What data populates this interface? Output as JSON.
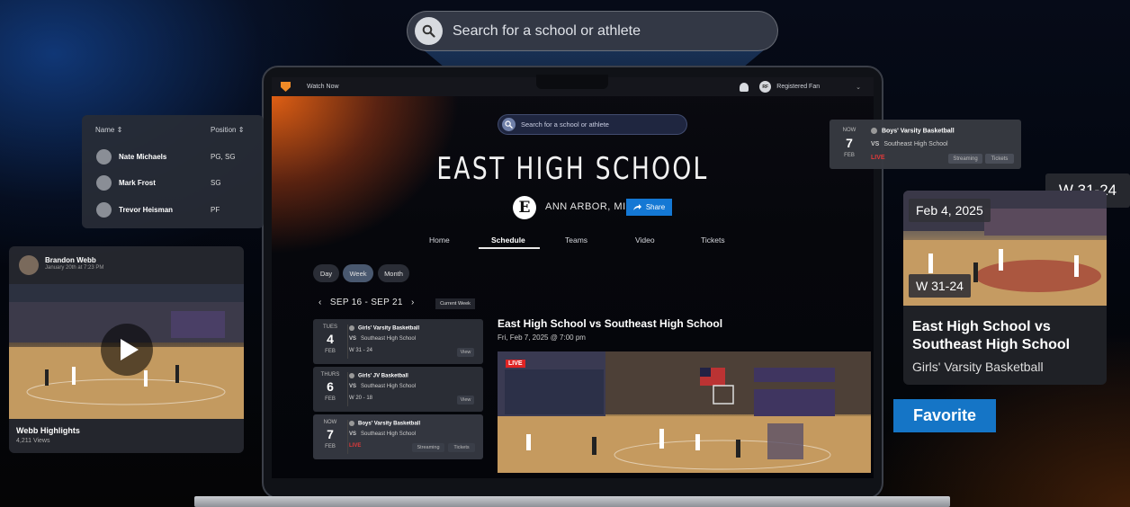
{
  "search": {
    "placeholder": "Search for a school or athlete"
  },
  "topbar": {
    "watch_now": "Watch Now",
    "user_initials": "RF",
    "user_label": "Registered Fan"
  },
  "school": {
    "search_placeholder": "Search for a school or athlete",
    "name": "EAST HIGH SCHOOL",
    "logo_letter": "E",
    "location": "ANN ARBOR, MI",
    "share_label": "Share"
  },
  "tabs": [
    "Home",
    "Schedule",
    "Teams",
    "Video",
    "Tickets"
  ],
  "active_tab": "Schedule",
  "view_toggle": [
    "Day",
    "Week",
    "Month"
  ],
  "active_view": "Week",
  "week": {
    "range": "SEP 16 - SEP 21",
    "current_label": "Current Week"
  },
  "schedule": [
    {
      "day": "TUES",
      "date": "4",
      "month": "FEB",
      "team": "Girls' Varsity Basketball",
      "vs": "VS",
      "opponent": "Southeast High School",
      "result": "W 31 - 24",
      "buttons": [
        "View"
      ]
    },
    {
      "day": "THURS",
      "date": "6",
      "month": "FEB",
      "team": "Girls' JV Basketball",
      "vs": "VS",
      "opponent": "Southeast High School",
      "result": "W 20 - 18",
      "buttons": [
        "View"
      ]
    },
    {
      "day": "NOW",
      "date": "7",
      "month": "FEB",
      "team": "Boys' Varsity Basketball",
      "vs": "VS",
      "opponent": "Southeast High School",
      "result": "LIVE",
      "buttons": [
        "Streaming",
        "Tickets"
      ]
    }
  ],
  "featured": {
    "title": "East High School vs Southeast High School",
    "date": "Fri, Feb 7, 2025 @ 7:00 pm",
    "live": "LIVE"
  },
  "roster": {
    "headers": {
      "name": "Name",
      "position": "Position"
    },
    "rows": [
      {
        "name": "Nate Michaels",
        "position": "PG, SG"
      },
      {
        "name": "Mark Frost",
        "position": "SG"
      },
      {
        "name": "Trevor Heisman",
        "position": "PF"
      }
    ]
  },
  "video_card": {
    "author": "Brandon Webb",
    "date": "January 20th at 7:23 PM",
    "title": "Webb Highlights",
    "views": "4,211 Views"
  },
  "live_card": {
    "day": "NOW",
    "date": "7",
    "month": "FEB",
    "team": "Boys' Varsity Basketball",
    "vs": "VS",
    "opponent": "Southeast High School",
    "status": "LIVE",
    "buttons": [
      "Streaming",
      "Tickets"
    ]
  },
  "score_tag": "W 31-24",
  "game_card": {
    "date": "Feb 4, 2025",
    "score": "W 31-24",
    "title": "East High School vs Southeast High School",
    "subtitle": "Girls' Varsity Basketball"
  },
  "favorite_label": "Favorite",
  "colors": {
    "accent_blue": "#1478d4",
    "live_red": "#e02424",
    "brand_orange": "#f08b27"
  }
}
